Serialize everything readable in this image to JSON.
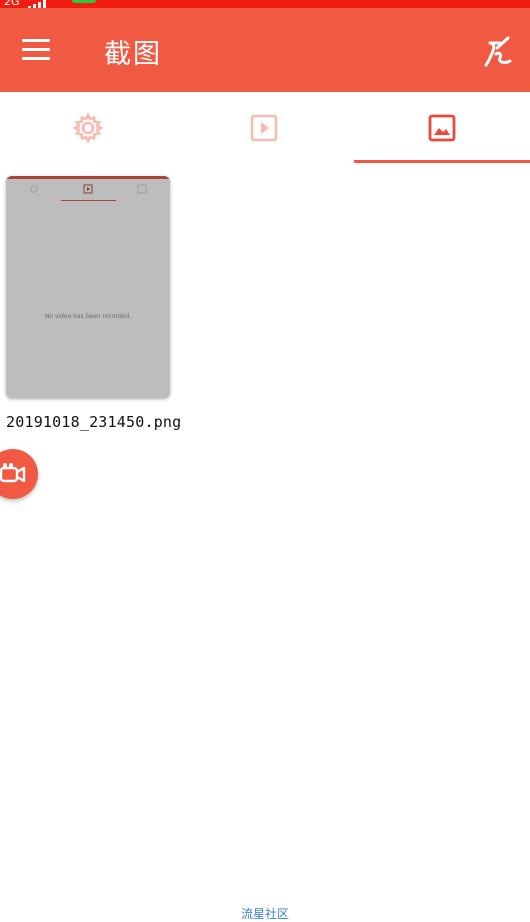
{
  "status_bar": {
    "network": "2G",
    "bar_color": "#f21d12"
  },
  "app_bar": {
    "title": "截图",
    "menu_icon": "hamburger-menu-icon",
    "action_icon": "brush-icon",
    "color": "#f05a42"
  },
  "tabs": [
    {
      "icon": "gear-icon",
      "selected": false
    },
    {
      "icon": "play-icon",
      "selected": false
    },
    {
      "icon": "image-icon",
      "selected": true
    }
  ],
  "gallery": {
    "items": [
      {
        "filename": "20191018_231450.png",
        "thumbnail_text": "No video has been recorded."
      }
    ]
  },
  "fab": {
    "icon": "video-camera-icon"
  },
  "footer": {
    "text": "流星社区"
  }
}
